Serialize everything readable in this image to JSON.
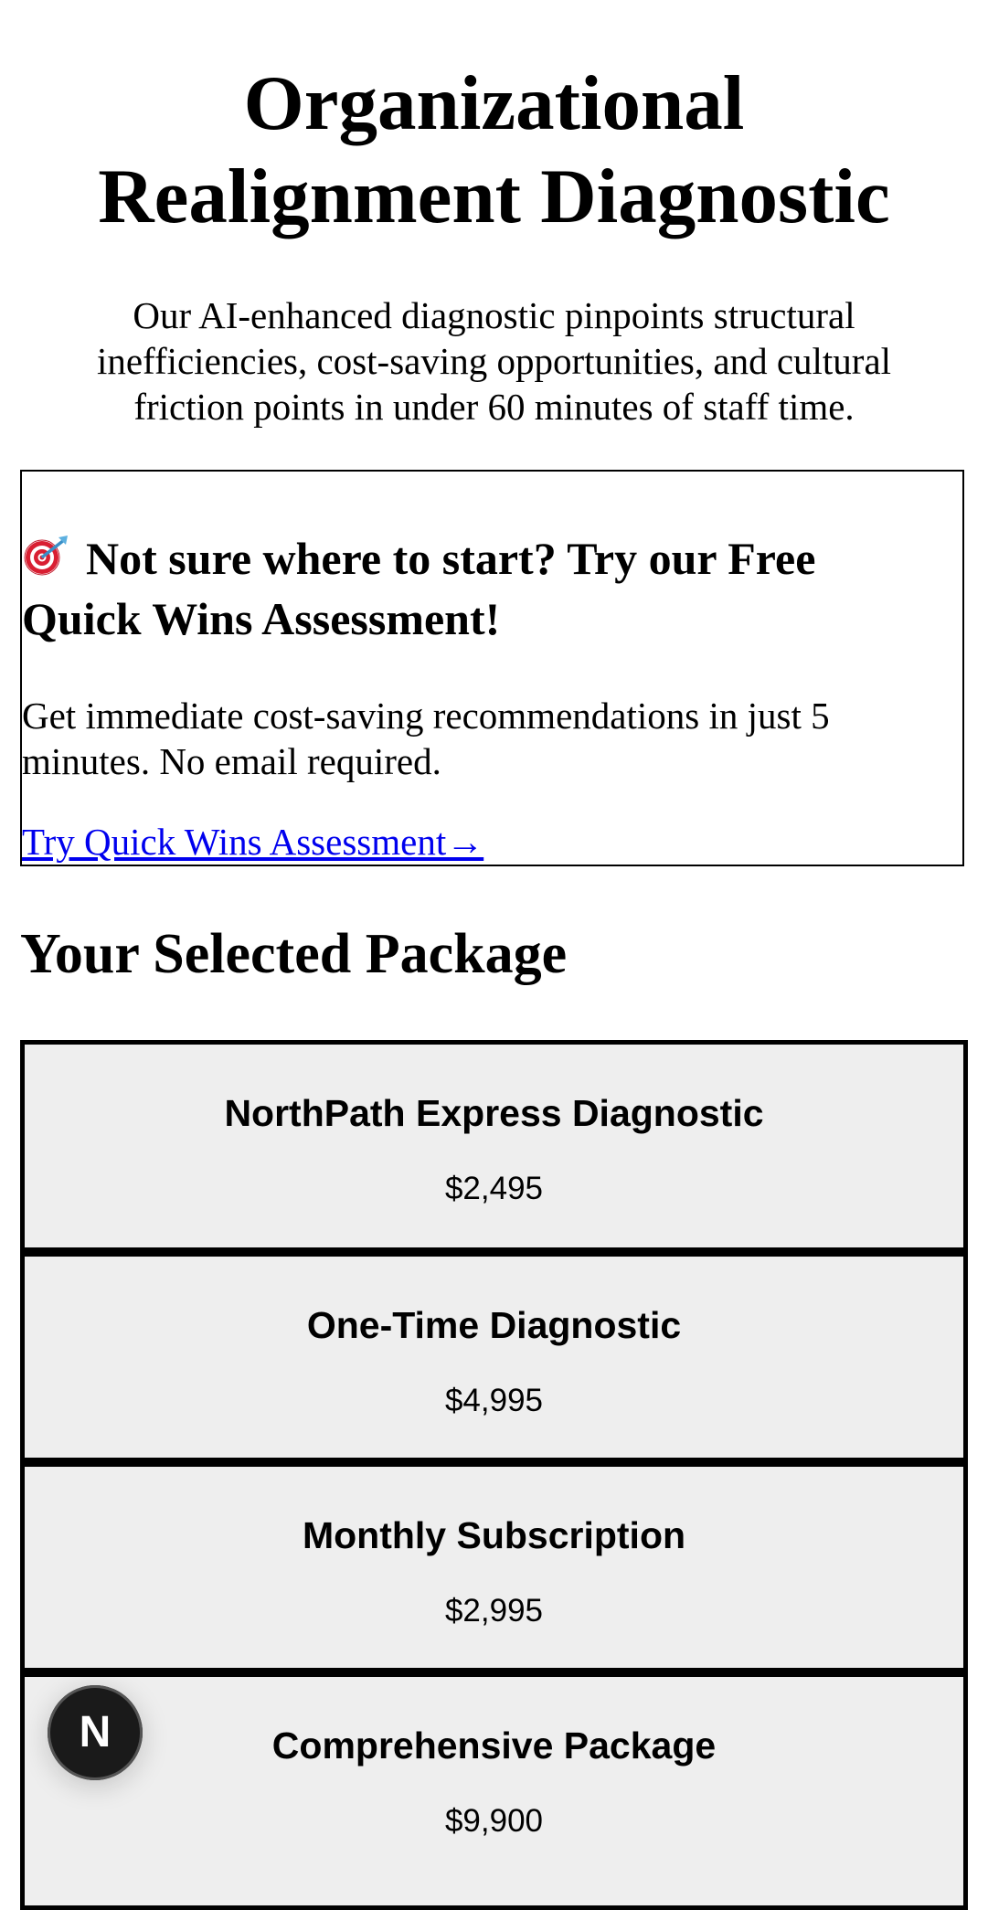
{
  "header": {
    "title": "Organizational Realignment Diagnostic",
    "intro": "Our AI-enhanced diagnostic pinpoints structural inefficiencies, cost-saving opportunities, and cultural friction points in under 60 minutes of staff time."
  },
  "promo": {
    "icon": "target-icon",
    "heading": "Not sure where to start? Try our Free Quick Wins Assessment!",
    "text": "Get immediate cost-saving recommendations in just 5 minutes. No email required.",
    "link_label": "Try Quick Wins Assessment→"
  },
  "packages_section": {
    "heading": "Your Selected Package",
    "items": [
      {
        "name": "NorthPath Express Diagnostic",
        "price": "$2,495"
      },
      {
        "name": "One-Time Diagnostic",
        "price": "$4,995"
      },
      {
        "name": "Monthly Subscription",
        "price": "$2,995"
      },
      {
        "name": "Comprehensive Package",
        "price": "$9,900"
      }
    ]
  },
  "fab": {
    "label": "N"
  },
  "colors": {
    "link": "#0000ee",
    "package_bg": "#eeeeee",
    "fab_bg": "#1a1a1a"
  }
}
